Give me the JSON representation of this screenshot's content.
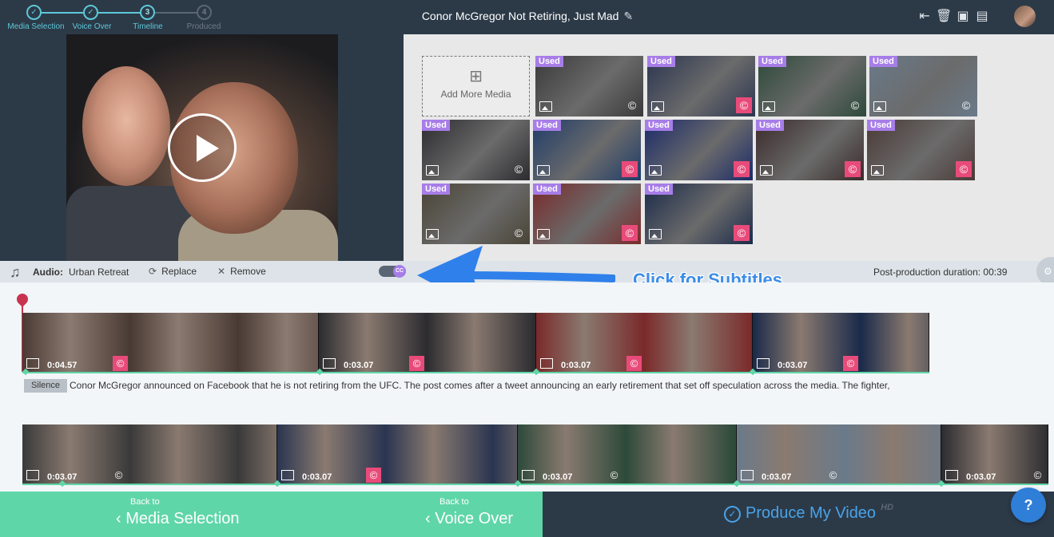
{
  "steps": [
    {
      "label": "Media Selection",
      "state": "done",
      "mark": "✓"
    },
    {
      "label": "Voice Over",
      "state": "done",
      "mark": "✓"
    },
    {
      "label": "Timeline",
      "state": "current",
      "mark": "3"
    },
    {
      "label": "Produced",
      "state": "todo",
      "mark": "4"
    }
  ],
  "project": {
    "title": "Conor McGregor Not Retiring, Just Mad"
  },
  "top_icons": [
    "exit-icon",
    "trash-icon",
    "save-icon",
    "comment-icon"
  ],
  "media": {
    "add_label": "Add More Media",
    "used_label": "Used",
    "items": [
      {
        "used": true,
        "copy": "neutral",
        "color": "#3a3a3a"
      },
      {
        "used": true,
        "copy": "pink",
        "color": "#2a3550"
      },
      {
        "used": true,
        "copy": "neutral",
        "color": "#2d4a3a"
      },
      {
        "used": true,
        "copy": "neutral",
        "color": "#6a7a8a"
      },
      {
        "used": true,
        "copy": "neutral",
        "color": "#2c2c30"
      },
      {
        "used": true,
        "copy": "pink",
        "color": "#1f3c6a"
      },
      {
        "used": true,
        "copy": "pink",
        "color": "#1a2a6a"
      },
      {
        "used": true,
        "copy": "pink",
        "color": "#3a2a2a"
      },
      {
        "used": true,
        "copy": "pink",
        "color": "#4a3a36"
      },
      {
        "used": true,
        "copy": "neutral",
        "color": "#4a4436"
      },
      {
        "used": true,
        "copy": "pink",
        "color": "#7a2a2a"
      },
      {
        "used": true,
        "copy": "pink",
        "color": "#1a2a4a"
      }
    ]
  },
  "audio": {
    "label": "Audio:",
    "name": "Urban Retreat",
    "replace_label": "Replace",
    "remove_label": "Remove",
    "cc_label": "CC",
    "duration_label": "Post-production duration: 00:39"
  },
  "callout": {
    "text": "Click for Subtitles"
  },
  "timeline": {
    "row1": [
      {
        "duration": "0:04.57",
        "copy": "pink",
        "color": "#4a3a34"
      },
      {
        "duration": "0:03.07",
        "copy": "pink",
        "color": "#2c2c30"
      },
      {
        "duration": "0:03.07",
        "copy": "pink",
        "color": "#7a2a2a"
      },
      {
        "duration": "0:03.07",
        "copy": "pink",
        "color": "#1a2a4a"
      }
    ],
    "row2": [
      {
        "duration": "0:03.07",
        "copy": "neutral",
        "color": "#3a3a3a"
      },
      {
        "duration": "0:03.07",
        "copy": "pink",
        "color": "#2a3550"
      },
      {
        "duration": "0:03.07",
        "copy": "neutral",
        "color": "#2d4a3a"
      },
      {
        "duration": "0:03.07",
        "copy": "neutral",
        "color": "#6a7a8a"
      },
      {
        "duration": "0:03.07",
        "copy": "neutral",
        "color": "#2c2c30"
      }
    ],
    "silence_label": "Silence",
    "transcript": "Conor McGregor announced on Facebook that he is not retiring from the UFC. The post comes after a tweet announcing an early retirement that set off speculation across the media. The fighter,"
  },
  "bottom": {
    "back_small": "Back to",
    "back_media": "Media Selection",
    "back_voice": "Voice Over",
    "produce_label": "Produce My Video",
    "hd_badge": "HD",
    "help_glyph": "?"
  },
  "colors": {
    "accent": "#5fd6a8",
    "used_badge": "#a77de8",
    "copyright": "#e84b7a",
    "callout": "#3c8ce8",
    "dark": "#2c3a48"
  }
}
